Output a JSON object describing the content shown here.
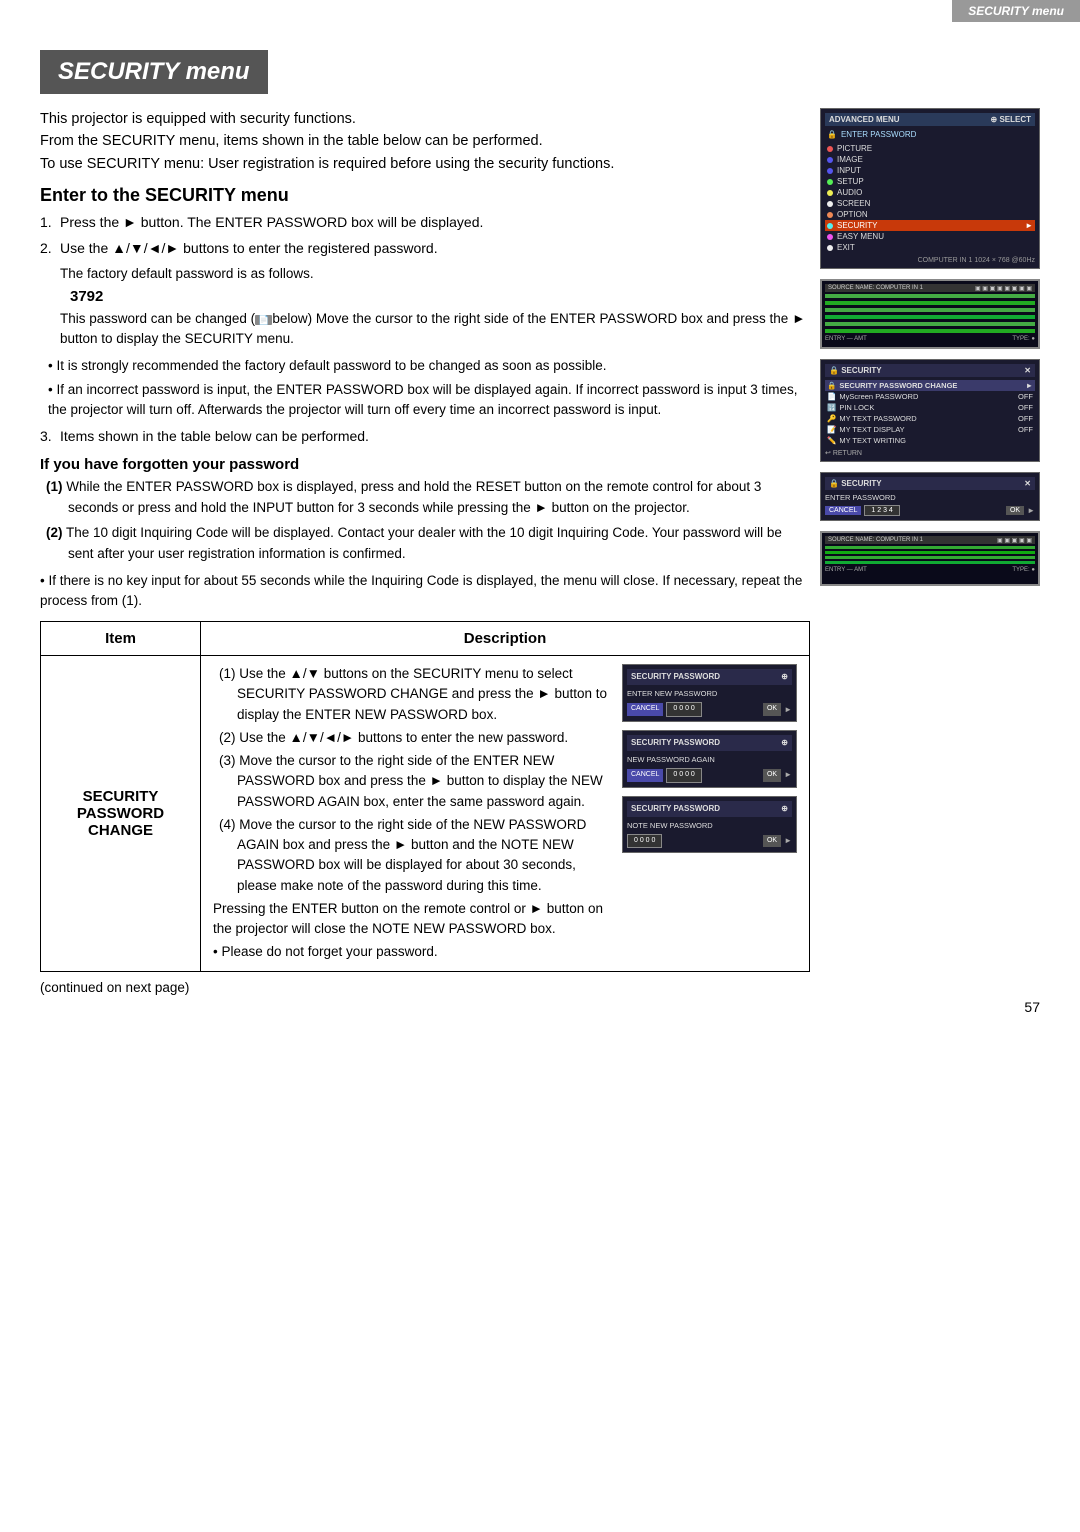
{
  "header": {
    "top_label": "SECURITY menu"
  },
  "title": "SECURITY menu",
  "intro_paragraphs": [
    "This projector is equipped with security functions.",
    "From the SECURITY menu, items shown in the table below can be performed.",
    "To use SECURITY menu: User registration is required before using the security functions."
  ],
  "section1": {
    "heading": "Enter to the SECURITY menu",
    "steps": [
      {
        "num": "1.",
        "text": "Press the ► button. The ENTER PASSWORD box will be displayed."
      },
      {
        "num": "2.",
        "text": "Use the ▲/▼/◄/► buttons to enter the registered password."
      }
    ],
    "sub_note_1": "The factory default password is as follows.",
    "password": "3792",
    "change_note": "This password can be changed (  below) Move the cursor to the right side of the ENTER PASSWORD box and press the ► button to display the SECURITY menu.",
    "bullet1": "• It is strongly recommended the factory default password to be changed as soon as possible.",
    "bullet2": "• If an incorrect password is input, the ENTER PASSWORD box will be displayed again. If incorrect password is input 3 times, the projector will turn off. Afterwards the projector will turn off every time an incorrect password is input.",
    "step3": {
      "num": "3.",
      "text": "Items shown in the table below can be performed."
    }
  },
  "section2": {
    "heading": "If you have forgotten your password",
    "steps": [
      {
        "num": "(1)",
        "text": "While the ENTER PASSWORD box is displayed, press and hold the RESET button on the remote control for about 3 seconds or press and hold the INPUT button for 3 seconds while pressing the ► button on the projector."
      },
      {
        "num": "(2)",
        "text": "The 10 digit Inquiring Code will be displayed. Contact your dealer with the 10 digit Inquiring Code. Your password will be sent after your user registration information is confirmed."
      }
    ],
    "info_note": "• If there is no key input for about 55 seconds while the Inquiring Code is displayed, the menu will close. If necessary, repeat the process from (1)."
  },
  "table": {
    "col_item": "Item",
    "col_description": "Description",
    "rows": [
      {
        "item": "SECURITY\nPASSWORD\nCHANGE",
        "description_parts": [
          "(1) Use the ▲/▼ buttons on the SECURITY menu to select SECURITY PASSWORD CHANGE and press the ► button to display the ENTER NEW PASSWORD box.",
          "(2) Use the ▲/▼/◄/► buttons to enter the new password.",
          "(3) Move the cursor to the right side of the ENTER NEW PASSWORD box and press the ► button to display the NEW PASSWORD AGAIN box, enter the same password again.",
          "(4) Move the cursor to the right side of the NEW PASSWORD AGAIN box and press the ► button and the NOTE NEW PASSWORD box will be displayed for about 30 seconds, please make note of the password during this time.",
          "Pressing the ENTER button on the remote control or ► button on the projector will close the NOTE NEW PASSWORD box.",
          "• Please do not forget your password."
        ]
      }
    ]
  },
  "footer": {
    "continued": "(continued on next page)",
    "page_number": "57"
  },
  "screenshots": {
    "adv_menu": {
      "title": "ADVANCED MENU",
      "select_label": "SELECT",
      "enter_password_label": "ENTER PASSWORD",
      "menu_items": [
        {
          "dot": "red",
          "label": "PICTURE"
        },
        {
          "dot": "blue",
          "label": "IMAGE"
        },
        {
          "dot": "blue",
          "label": "INPUT"
        },
        {
          "dot": "green",
          "label": "SETUP"
        },
        {
          "dot": "yellow",
          "label": "AUDIO"
        },
        {
          "dot": "white",
          "label": "SCREEN"
        },
        {
          "dot": "orange",
          "label": "OPTION"
        },
        {
          "dot": "cyan",
          "label": "SECURITY",
          "selected": true
        },
        {
          "dot": "pink",
          "label": "EASY MENU"
        },
        {
          "dot": "white",
          "label": "EXIT"
        }
      ],
      "footer": "COMPUTER IN 1    1024 × 768 @60Hz"
    },
    "pixel_screen": {
      "source": "SOURCE NAME: COMPUTER IN 1"
    },
    "security_menu": {
      "title": "SECURITY",
      "close_icon": "✕",
      "items": [
        {
          "label": "SECURITY PASSWORD CHANGE",
          "value": "",
          "arrow": "►"
        },
        {
          "label": "MyScreen PASSWORD",
          "value": "OFF"
        },
        {
          "label": "PIN LOCK",
          "value": "OFF"
        },
        {
          "label": "MY TEXT PASSWORD",
          "value": "OFF"
        },
        {
          "label": "MY TEXT DISPLAY",
          "value": "OFF"
        },
        {
          "label": "MY TEXT WRITING",
          "value": ""
        }
      ],
      "return_label": "RETURN"
    },
    "enter_password": {
      "title": "SECURITY",
      "close_icon": "✕",
      "sub_label": "ENTER PASSWORD",
      "cancel_label": "CANCEL",
      "digits": "1 2 3 4",
      "ok_label": "OK"
    },
    "pixel_screen2": {
      "source": "SOURCE NAME: COMPUTER IN 1"
    },
    "security_password_enter": {
      "title": "SECURITY PASSWORD",
      "close_icon": "⊕",
      "sub_label": "ENTER NEW PASSWORD",
      "cancel_label": "CANCEL",
      "digits": "0 0 0 0",
      "ok_label": "OK"
    },
    "security_password_again": {
      "title": "SECURITY PASSWORD",
      "close_icon": "⊕",
      "sub_label": "NEW PASSWORD AGAIN",
      "cancel_label": "CANCEL",
      "digits": "0 0 0 0",
      "ok_label": "OK"
    },
    "security_password_note": {
      "title": "SECURITY PASSWORD",
      "close_icon": "⊕",
      "sub_label": "NOTE NEW PASSWORD",
      "digits": "0 0 0 0",
      "ok_label": "OK"
    }
  }
}
